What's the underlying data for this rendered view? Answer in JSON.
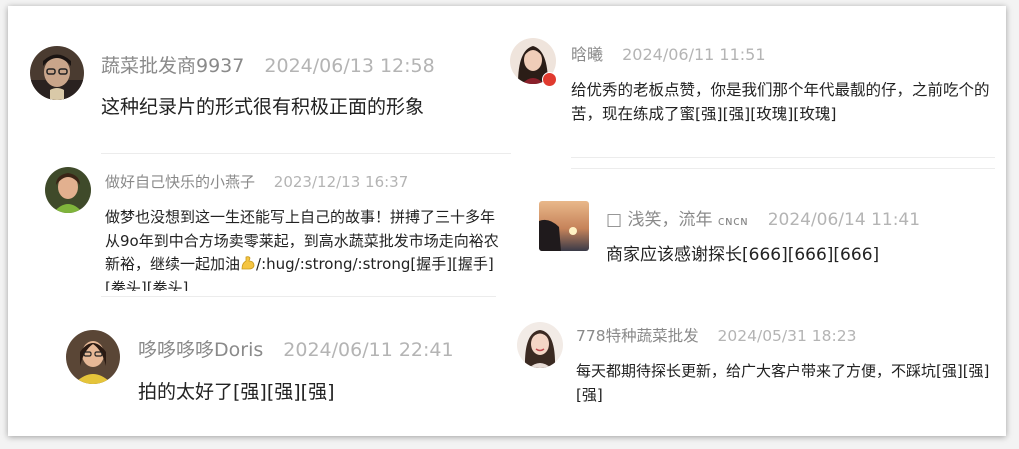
{
  "comments": [
    {
      "author": "蔬菜批发商9937",
      "time": "2024/06/13 12:58",
      "text": "这种纪录片的形式很有积极正面的形象",
      "avatar": "man-with-glasses-avatar"
    },
    {
      "author": "做好自己快乐的小燕子",
      "time": "2023/12/13 16:37",
      "text_before": "做梦也没想到这一生还能写上自己的故事！拼搏了三十多年从9o年到中合方场卖零莱起，到高水蔬菜批发市场走向裕农新裕，继续一起加油",
      "text_after": "/:hug/:strong/:strong[握手][握手][拳头][拳头]",
      "emoji": "flexed-biceps-icon",
      "avatar": "woman-avatar"
    },
    {
      "author": "哆哆哆哆Doris",
      "time": "2024/06/11 22:41",
      "text": "拍的太好了[强][强][强]",
      "avatar": "woman-yellow-shirt-avatar"
    },
    {
      "author": "晗曦",
      "time": "2024/06/11 11:51",
      "text": "给优秀的老板点赞，你是我们那个年代最靓的仔，之前吃个的苦，现在练成了蜜[强][强][玫瑰][玫瑰]",
      "avatar": "woman-portrait-avatar"
    },
    {
      "author_glyph": "□",
      "author": "浅笑，流年",
      "author_suffix": "ᴄɴᴄɴ",
      "time": "2024/06/14 11:41",
      "text": "商家应该感谢探长[666][666][666]",
      "avatar": "sunset-hand-avatar"
    },
    {
      "author": "778特种蔬菜批发",
      "time": "2024/05/31 18:23",
      "text": "每天都期待探长更新，给广大客户带来了方便，不踩坑[强][强][强]",
      "avatar": "woman-smiling-avatar"
    }
  ]
}
